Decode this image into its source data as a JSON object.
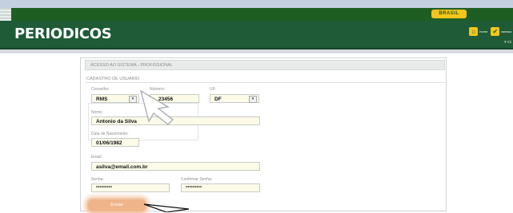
{
  "header": {
    "brand_badge": "BRASIL",
    "logo": "PERIODICOS",
    "tools": [
      {
        "label": "home"
      },
      {
        "label": "acesso"
      }
    ],
    "sub_link": "▾ cs"
  },
  "form": {
    "panel_title": "ACESSO AO SISTEMA - PROFISSIONAL",
    "section": "CADASTRO DE USUÁRIO",
    "conselho": {
      "label": "Conselho:",
      "value": "RMS"
    },
    "numero": {
      "label": "Número:",
      "value": "23456"
    },
    "uf": {
      "label": "UF:",
      "value": "DF"
    },
    "nome": {
      "label": "Nome:",
      "value": "Antonio da Silva"
    },
    "nascimento": {
      "label": "Data de Nascimento:",
      "value": "01/06/1982"
    },
    "email": {
      "label": "Email:",
      "value": "asilva@email.com.br"
    },
    "senha": {
      "label": "Senha:",
      "value": "*********"
    },
    "confirmar_senha": {
      "label": "Confirmar Senha:",
      "value": "*********"
    },
    "submit_label": "Enviar"
  },
  "colors": {
    "header_green": "#1e5b36",
    "top_green": "#1f5e22",
    "badge_yellow": "#f4c51b",
    "field_bg": "#fbfbe8",
    "button_orange": "#f0b48a"
  }
}
